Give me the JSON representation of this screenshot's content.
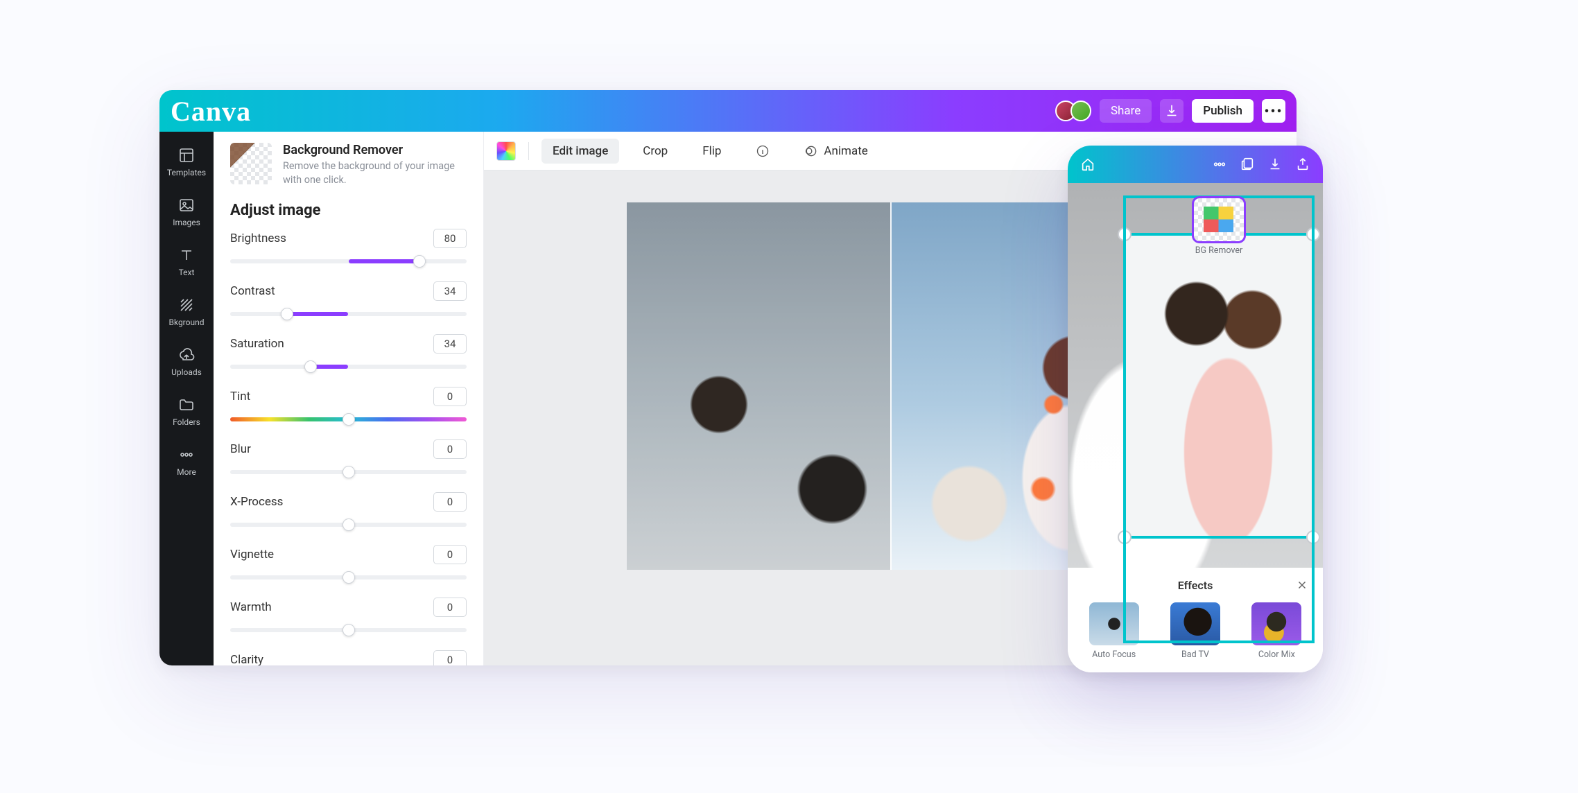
{
  "header": {
    "logo": "Canva",
    "share": "Share",
    "publish": "Publish"
  },
  "rail": {
    "items": [
      {
        "label": "Templates",
        "icon": "templates"
      },
      {
        "label": "Images",
        "icon": "images"
      },
      {
        "label": "Text",
        "icon": "text"
      },
      {
        "label": "Bkground",
        "icon": "background"
      },
      {
        "label": "Uploads",
        "icon": "uploads"
      },
      {
        "label": "Folders",
        "icon": "folders"
      },
      {
        "label": "More",
        "icon": "more"
      }
    ]
  },
  "panel": {
    "bg_remover": {
      "title": "Background Remover",
      "subtitle": "Remove the background of your image with one click."
    },
    "section_title": "Adjust image",
    "sliders": [
      {
        "label": "Brightness",
        "value": "80",
        "fill_from": 50,
        "fill_to": 80,
        "knob": 80,
        "rainbow": false
      },
      {
        "label": "Contrast",
        "value": "34",
        "fill_from": 24,
        "fill_to": 50,
        "knob": 24,
        "rainbow": false
      },
      {
        "label": "Saturation",
        "value": "34",
        "fill_from": 34,
        "fill_to": 50,
        "knob": 34,
        "rainbow": false
      },
      {
        "label": "Tint",
        "value": "0",
        "fill_from": 50,
        "fill_to": 50,
        "knob": 50,
        "rainbow": true
      },
      {
        "label": "Blur",
        "value": "0",
        "fill_from": 50,
        "fill_to": 50,
        "knob": 50,
        "rainbow": false
      },
      {
        "label": "X-Process",
        "value": "0",
        "fill_from": 50,
        "fill_to": 50,
        "knob": 50,
        "rainbow": false
      },
      {
        "label": "Vignette",
        "value": "0",
        "fill_from": 50,
        "fill_to": 50,
        "knob": 50,
        "rainbow": false
      },
      {
        "label": "Warmth",
        "value": "0",
        "fill_from": 50,
        "fill_to": 50,
        "knob": 50,
        "rainbow": false
      },
      {
        "label": "Clarity",
        "value": "0",
        "fill_from": 50,
        "fill_to": 50,
        "knob": 50,
        "rainbow": false
      }
    ]
  },
  "toolbar": {
    "edit": "Edit image",
    "crop": "Crop",
    "flip": "Flip",
    "animate": "Animate"
  },
  "mobile": {
    "effects_title": "Effects",
    "effects": [
      {
        "label": "BG Remover",
        "selected": true
      },
      {
        "label": "Auto Focus",
        "selected": false
      },
      {
        "label": "Bad TV",
        "selected": false
      },
      {
        "label": "Color Mix",
        "selected": false
      }
    ]
  }
}
